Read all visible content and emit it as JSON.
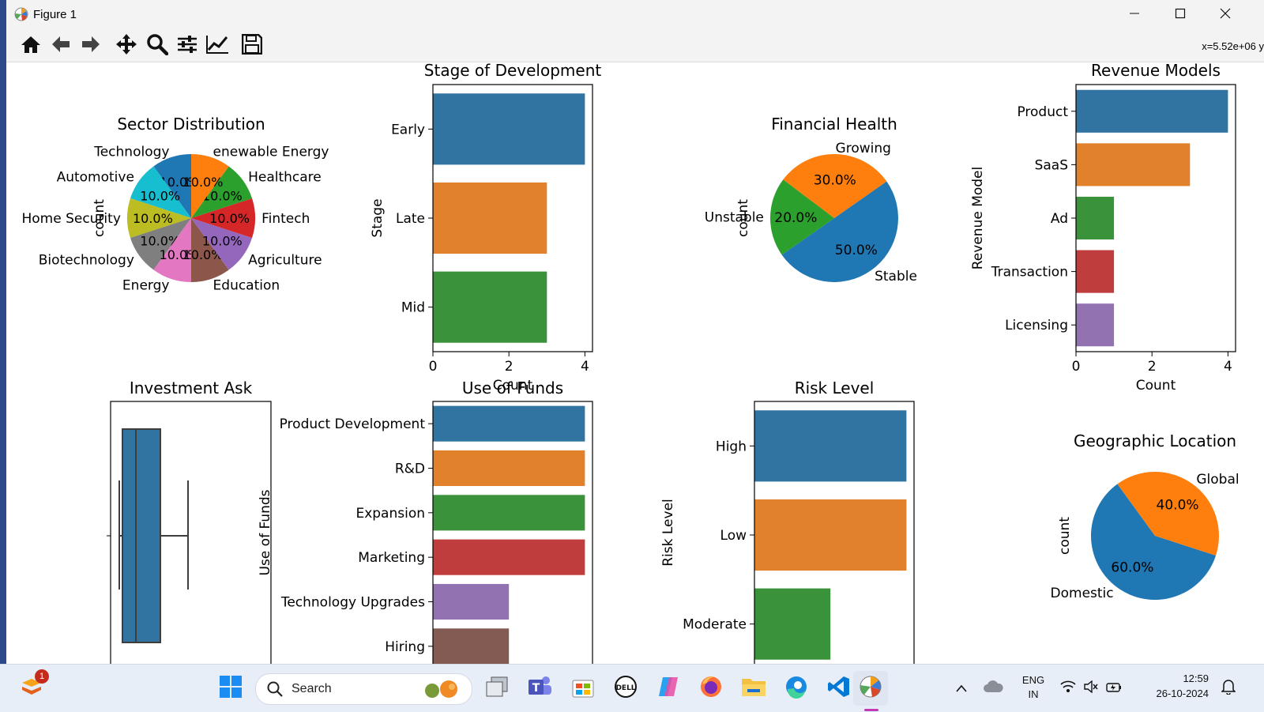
{
  "window": {
    "title": "Figure 1",
    "app_icon": "matplotlib-icon"
  },
  "toolbar": {
    "buttons": [
      "home-icon",
      "back-icon",
      "forward-icon",
      "pan-icon",
      "zoom-icon",
      "configure-subplots-icon",
      "edit-axis-icon",
      "save-icon"
    ],
    "coords": "x=5.52e+06 y"
  },
  "chart_data": [
    {
      "type": "pie",
      "title": "Sector Distribution",
      "ylabel": "count",
      "categories": [
        "Technology",
        "Automotive",
        "Home Security",
        "Biotechnology",
        "Energy",
        "Education",
        "Agriculture",
        "Fintech",
        "Healthcare",
        "Renewable Energy"
      ],
      "values": [
        10,
        10,
        10,
        10,
        10,
        10,
        10,
        10,
        10,
        10
      ],
      "pct_labels": [
        "10.0%",
        "10.0%",
        "10.0%",
        "10.0%",
        "10.0%",
        "10.0%",
        "10.0%",
        "10.0%",
        "10.0%",
        "10.0%"
      ],
      "label_texts": [
        "Technology",
        "Automotive",
        "Home Security",
        "Biotechnology",
        "Energy",
        "Education",
        "Agriculture",
        "Fintech",
        "Healthcare",
        "enewable Energy"
      ],
      "colors": [
        "#1f77b4",
        "#17becf",
        "#bcbd22",
        "#7f7f7f",
        "#e377c2",
        "#8c564b",
        "#9467bd",
        "#d62728",
        "#2ca02c",
        "#ff7f0e"
      ]
    },
    {
      "type": "bar",
      "orientation": "horizontal",
      "title": "Stage of Development",
      "xlabel": "Count",
      "ylabel": "Stage",
      "categories": [
        "Early",
        "Late",
        "Mid"
      ],
      "values": [
        4,
        3,
        3
      ],
      "xlim": [
        0,
        4.2
      ],
      "xticks": [
        "0",
        "2",
        "4"
      ],
      "colors": [
        "#3274a1",
        "#e1812c",
        "#3a923a"
      ]
    },
    {
      "type": "pie",
      "title": "Financial Health",
      "ylabel": "count",
      "categories": [
        "Stable",
        "Growing",
        "Unstable"
      ],
      "values": [
        50,
        30,
        20
      ],
      "pct_labels": [
        "50.0%",
        "30.0%",
        "20.0%"
      ],
      "colors": [
        "#1f77b4",
        "#ff7f0e",
        "#2ca02c"
      ]
    },
    {
      "type": "bar",
      "orientation": "horizontal",
      "title": "Revenue Models",
      "xlabel": "Count",
      "ylabel": "Revenue Model",
      "categories": [
        "Product",
        "SaaS",
        "Ad",
        "Transaction",
        "Licensing"
      ],
      "values": [
        4,
        3,
        1,
        1,
        1
      ],
      "xlim": [
        0,
        4.2
      ],
      "xticks": [
        "0",
        "2",
        "4"
      ],
      "colors": [
        "#3274a1",
        "#e1812c",
        "#3a923a",
        "#c03d3e",
        "#9372b2"
      ]
    },
    {
      "type": "box",
      "title": "Investment Ask"
    },
    {
      "type": "bar",
      "orientation": "horizontal",
      "title": "Use of Funds",
      "ylabel": "Use of Funds",
      "categories": [
        "Product Development",
        "R&D",
        "Expansion",
        "Marketing",
        "Technology Upgrades",
        "Hiring"
      ],
      "values": [
        4,
        4,
        4,
        4,
        2,
        2
      ],
      "xlim": [
        0,
        4.2
      ],
      "colors": [
        "#3274a1",
        "#e1812c",
        "#3a923a",
        "#c03d3e",
        "#9372b2",
        "#845b53"
      ]
    },
    {
      "type": "bar",
      "orientation": "horizontal",
      "title": "Risk Level",
      "ylabel": "Risk Level",
      "categories": [
        "High",
        "Low",
        "Moderate"
      ],
      "values": [
        4,
        4,
        2
      ],
      "xlim": [
        0,
        4.2
      ],
      "colors": [
        "#3274a1",
        "#e1812c",
        "#3a923a"
      ]
    },
    {
      "type": "pie",
      "title": "Geographic Location",
      "ylabel": "count",
      "categories": [
        "Domestic",
        "Global"
      ],
      "values": [
        60,
        40
      ],
      "pct_labels": [
        "60.0%",
        "40.0%"
      ],
      "colors": [
        "#1f77b4",
        "#ff7f0e"
      ]
    }
  ],
  "taskbar": {
    "search_label": "Search",
    "notification_badge": "1",
    "lang_line1": "ENG",
    "lang_line2": "IN",
    "time": "12:59",
    "date": "26-10-2024",
    "pinned": [
      "widgets-icon",
      "windows-start-icon",
      "task-view-icon",
      "teams-icon",
      "store-icon",
      "dell-icon",
      "copilot-icon",
      "firefox-icon",
      "file-explorer-icon",
      "edge-icon",
      "vscode-icon",
      "matplotlib-icon"
    ]
  }
}
